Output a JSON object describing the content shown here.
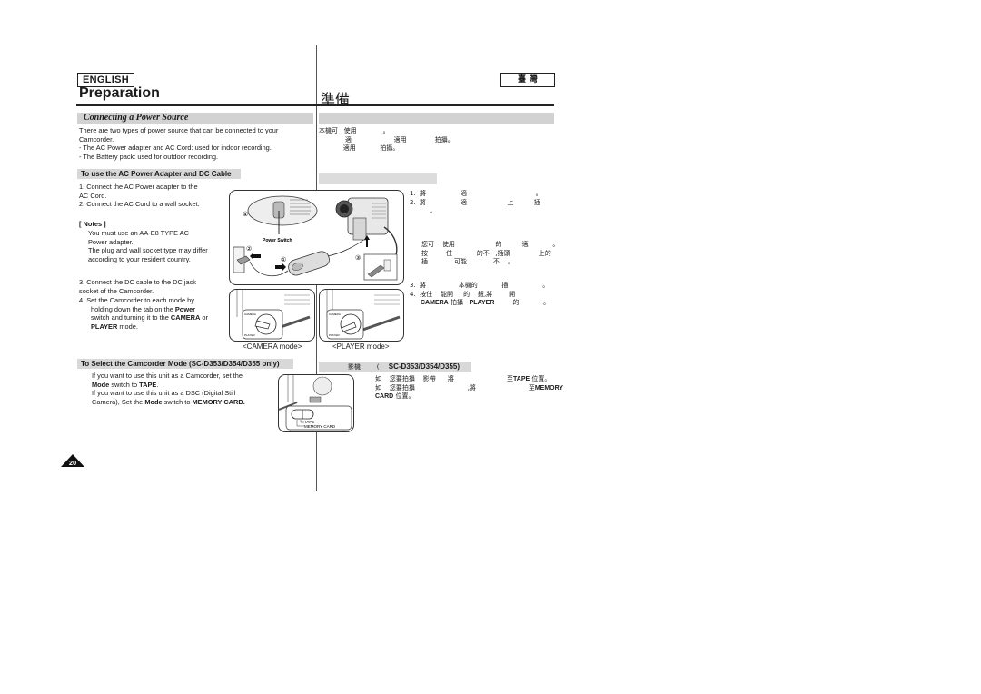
{
  "left": {
    "language_label": "ENGLISH",
    "page_title": "Preparation",
    "section_title": "Connecting a Power Source",
    "intro": [
      "There are two types of power source that can be connected to your",
      "Camcorder.",
      "-  The AC Power adapter and AC Cord: used for indoor recording.",
      "-  The Battery pack: used for outdoor recording."
    ],
    "subsection1": {
      "title": "To use the AC Power Adapter and DC Cable",
      "steps_a": [
        "1.  Connect the AC Power adapter to the",
        "     AC Cord.",
        "2.  Connect the AC Cord to a wall socket."
      ],
      "notes_label": "[ Notes ]",
      "notes": [
        "You must use an AA-E8 TYPE AC",
        "Power adapter.",
        "The plug and wall socket type may differ",
        "according to your resident country."
      ],
      "step3": [
        "3.  Connect the DC cable to the DC jack",
        "     socket of the Camcorder."
      ],
      "step4": {
        "line1": "4.  Set the Camcorder to each mode by",
        "line2_pre": "holding down the tab on the ",
        "line2_bold": "Power",
        "line3_pre": "switch and turning it to the ",
        "line3_bold": "CAMERA",
        "line3_post": " or",
        "line4_bold": "PLAYER",
        "line4_post": " mode."
      }
    },
    "subsection2": {
      "title": "To Select the Camcorder Mode (SC-D353/D354/D355 only)",
      "line1": "If you want to use this unit as a Camcorder, set the",
      "line2_b1": "Mode",
      "line2_mid": " switch to ",
      "line2_b2": "TAPE",
      "line2_end": ".",
      "line3": "If you want to use this unit as a DSC (Digital Still",
      "line4_pre": "Camera), Set the ",
      "line4_b1": "Mode",
      "line4_mid": " switch to ",
      "line4_b2": "MEMORY CARD."
    },
    "page_number": "20"
  },
  "figures": {
    "power_switch_label": "Power Switch",
    "markers": [
      "①",
      "②",
      "③",
      "④"
    ],
    "camera_mode_caption": "<CAMERA mode>",
    "player_mode_caption": "<PLAYER mode>",
    "dial_labels": [
      "CAMERA",
      "PLAYER"
    ],
    "mode_switch_labels": [
      "TAPE",
      "MEMORY CARD"
    ]
  },
  "right": {
    "language_label": "臺  灣",
    "page_title": "準備",
    "intro": [
      "本機可   使用             。",
      "             適                     適用              拍攝。",
      "            適用            拍攝。"
    ],
    "steps_a": [
      "1.  將                 適                                  。",
      "2.  將                 適                    上          插",
      "          。"
    ],
    "notes": [
      "您可    使用                    的          適            。",
      "按         住            的不   ,插頭              上的",
      "插             可能             不    。"
    ],
    "step3": "3.  將                本機的            插                 。",
    "step4_line1": "4.  按住    能開     的    鈕,將        開",
    "step4_line2_b1": "CAMERA",
    "step4_line2_mid": " 拍攝   ",
    "step4_line2_b2": "PLAYER",
    "step4_line2_end": "         的            。",
    "subsection2_title_pre": "影機        (",
    "subsection2_title_model": "SC-D353/D354/D355)",
    "sub2_line1_pre": "如    您要拍攝    影帶      將                          至",
    "sub2_line1_bold": "TAPE",
    "sub2_line1_end": " 位置。",
    "sub2_line2_pre": "如    您要拍攝                          ,將                          至",
    "sub2_line2_bold": "MEMORY",
    "sub2_line3_bold": "CARD",
    "sub2_line3_end": " 位置。"
  }
}
